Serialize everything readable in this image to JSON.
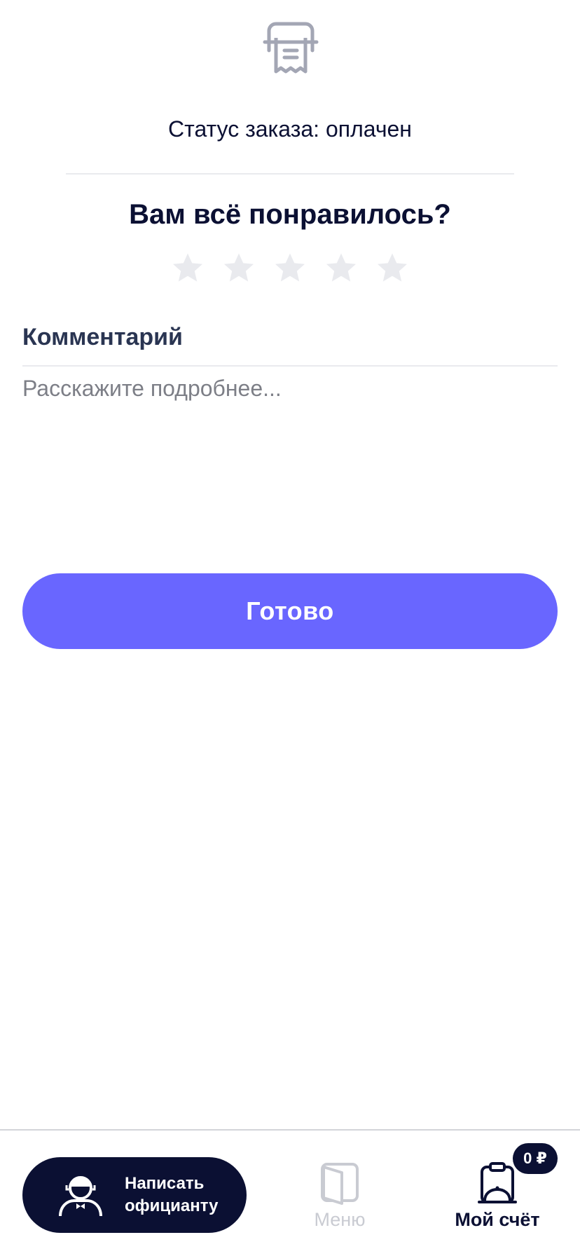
{
  "order": {
    "status_text": "Статус заказа: оплачен"
  },
  "rating": {
    "question": "Вам всё понравилось?",
    "max_stars": 5,
    "selected_stars": 0,
    "star_inactive_color": "#e9eaee"
  },
  "comment": {
    "label": "Комментарий",
    "placeholder": "Расскажите подробнее...",
    "value": ""
  },
  "actions": {
    "done_label": "Готово"
  },
  "bottom_nav": {
    "waiter_button_label": "Написать\nофицианту",
    "menu_label": "Меню",
    "bill_label": "Мой счёт",
    "bill_badge": "0 ₽"
  },
  "icons": {
    "top": "receipt-icon",
    "waiter": "waiter-icon",
    "menu": "menu-book-icon",
    "bill": "clipboard-cloche-icon",
    "star": "star-icon"
  },
  "colors": {
    "primary": "#6966ff",
    "dark": "#0b1033",
    "muted": "#c9cbd2",
    "placeholder": "#7d7f87"
  }
}
